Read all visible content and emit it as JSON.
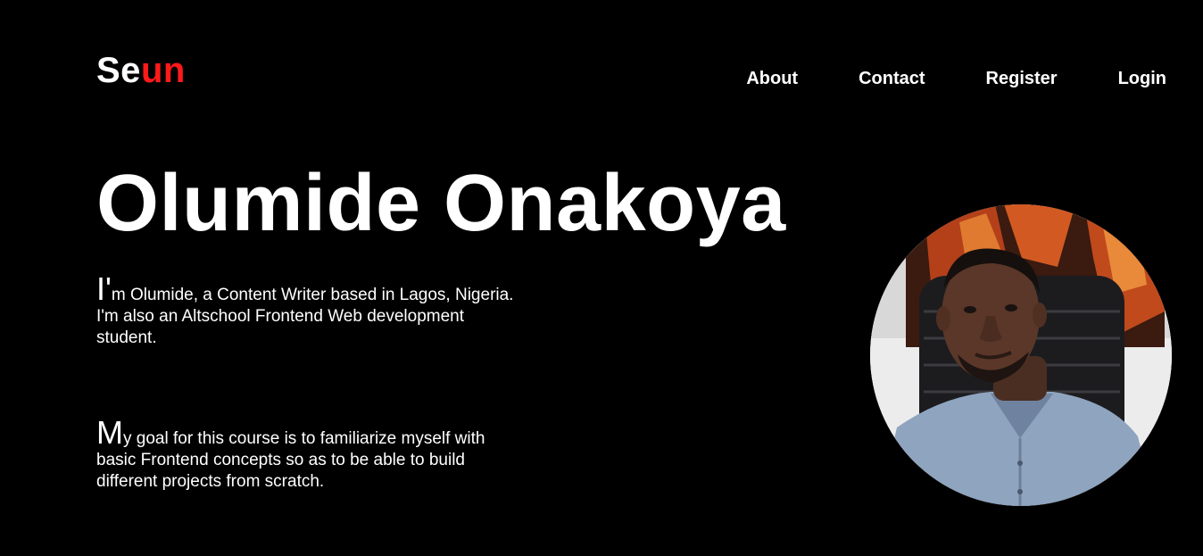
{
  "header": {
    "logo": {
      "part1": "Se",
      "part2": "un"
    },
    "nav": [
      {
        "label": "About"
      },
      {
        "label": "Contact"
      },
      {
        "label": "Register"
      },
      {
        "label": "Login"
      }
    ]
  },
  "hero": {
    "name": "Olumide Onakoya",
    "intro": {
      "initial": "I'",
      "rest": "m Olumide, a Content Writer based in Lagos, Nigeria. I'm also an Altschool Frontend Web development student."
    },
    "goal": {
      "initial": "M",
      "rest": "y goal for this course is to familiarize myself with basic Frontend concepts so as to be able to build different projects from scratch."
    }
  },
  "colors": {
    "background": "#000000",
    "text": "#ffffff",
    "accent": "#ff1a1a"
  }
}
